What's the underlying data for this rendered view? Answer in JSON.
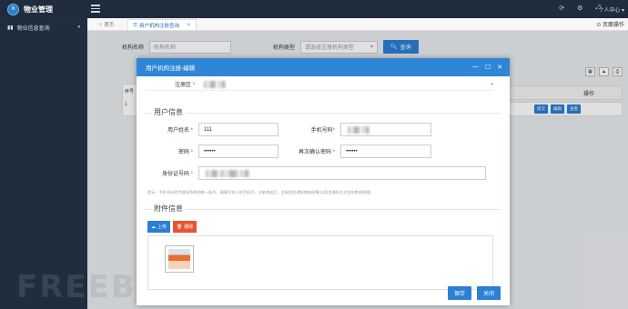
{
  "app": {
    "title": "物业管理",
    "logo_text": "N"
  },
  "topbar": {
    "menu_icon": "hamburger-icon",
    "icons": [
      "refresh-icon",
      "bell-icon",
      "fullscreen-icon"
    ],
    "user_center": "个人中心 ▾"
  },
  "sidebar": {
    "items": [
      {
        "label": "物业信息查询",
        "icon": "chart-icon"
      }
    ]
  },
  "tabs": {
    "home": "首页",
    "active": "用户机构注册查询",
    "page_action": "页面操作"
  },
  "search": {
    "org_name_label": "机构名称",
    "org_name_placeholder": "机构名称",
    "org_type_label": "机构类型",
    "org_type_placeholder": "请选择注册机构类型",
    "query_button": "查询"
  },
  "table": {
    "left_header": "序号",
    "left_row_value": "1",
    "op_header": "操作",
    "op_buttons": [
      "提交",
      "编辑",
      "查看"
    ]
  },
  "modal": {
    "title": "用户机构注册-编辑",
    "controls": [
      "—",
      "☐",
      "✕"
    ],
    "region_label": "注册区",
    "user_section": "用户信息",
    "fields": {
      "username_label": "用户姓名",
      "username_value": "111",
      "phone_label": "手机号码",
      "password_label": "密码",
      "password_value": "••••••",
      "confirm_label": "再次确认密码",
      "confirm_value": "••••••",
      "idcard_label": "身份证号码"
    },
    "hint": "提示：手机号码作为登录系统的唯一账号，请填写本人的手机号，注册完成后，会有短信通知审核结果(以短信通知方式告知审核结果)",
    "attachment_section": "附件信息",
    "upload_button": "上传",
    "delete_button": "删除",
    "save_button": "保存",
    "close_button": "关闭"
  },
  "watermark": "FREEBUF"
}
